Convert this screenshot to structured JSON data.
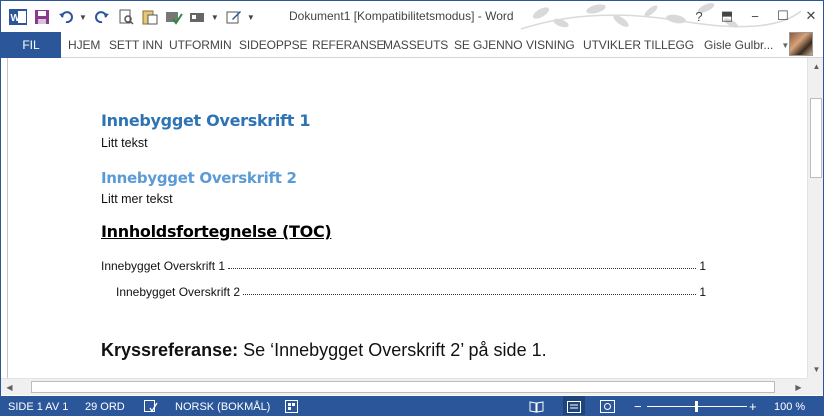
{
  "title_bar": {
    "document_title": "Dokument1 [Kompatibilitetsmodus] - Word",
    "qat_icons": [
      "word-icon",
      "save-icon",
      "undo-icon",
      "redo-icon",
      "print-preview-icon",
      "paste-icon",
      "spellcheck-icon",
      "toolbar-icon",
      "customize-icon"
    ],
    "window_controls": {
      "help": "?",
      "ribbon_options": "⬒",
      "minimize": "−",
      "maximize": "☐",
      "close": "✕"
    }
  },
  "ribbon": {
    "file_tab": "FIL",
    "tabs": [
      "HJEM",
      "SETT INN",
      "UTFORMIN",
      "SIDEOPPSE",
      "REFERANSE",
      "MASSEUTS",
      "SE GJENNO",
      "VISNING",
      "UTVIKLER",
      "TILLEGG"
    ],
    "user_name": "Gisle Gulbr..."
  },
  "document": {
    "heading1": "Innebygget Overskrift 1",
    "text1": "Litt tekst",
    "heading2": "Innebygget Overskrift 2",
    "text2": "Litt mer tekst",
    "toc_heading": "Innholdsfortegnelse (TOC)",
    "toc_entries": [
      {
        "text": "Innebygget Overskrift 1",
        "page": "1"
      },
      {
        "text": "Innebygget Overskrift 2",
        "page": "1"
      }
    ],
    "xref_label": "Kryssreferanse:",
    "xref_text": " Se ‘Innebygget Overskrift 2’ på side 1."
  },
  "status_bar": {
    "page": "SIDE 1 AV 1",
    "words": "29 ORD",
    "language": "NORSK (BOKMÅL)",
    "zoom": "100 %",
    "zoom_minus": "−",
    "zoom_plus": "+"
  },
  "colors": {
    "brand_blue": "#2b579a",
    "heading1": "#2e74b5",
    "heading2": "#5b9bd5"
  }
}
